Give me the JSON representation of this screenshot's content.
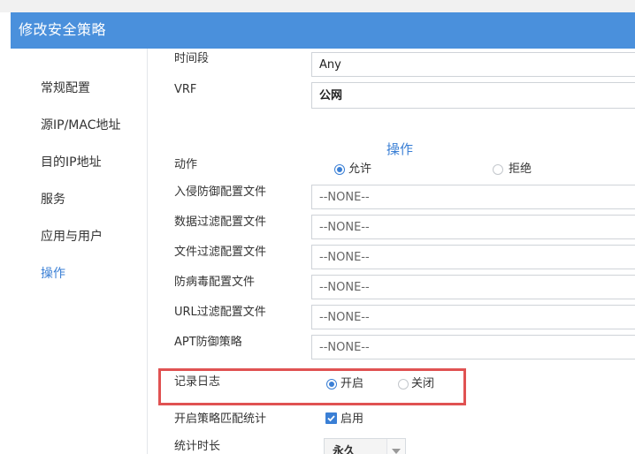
{
  "window": {
    "title": "修改安全策略"
  },
  "sidebar": {
    "items": [
      {
        "label": "常规配置"
      },
      {
        "label": "源IP/MAC地址"
      },
      {
        "label": "目的IP地址"
      },
      {
        "label": "服务"
      },
      {
        "label": "应用与用户"
      },
      {
        "label": "操作",
        "active": true
      }
    ]
  },
  "main": {
    "time_label": "时间段",
    "time_value": "Any",
    "vrf_label": "VRF",
    "vrf_value": "公网",
    "section_title": "操作",
    "action": {
      "label": "动作",
      "options": [
        "允许",
        "拒绝"
      ],
      "selected": "允许"
    },
    "profiles": [
      {
        "label": "入侵防御配置文件",
        "value": "--NONE--"
      },
      {
        "label": "数据过滤配置文件",
        "value": "--NONE--"
      },
      {
        "label": "文件过滤配置文件",
        "value": "--NONE--"
      },
      {
        "label": "防病毒配置文件",
        "value": "--NONE--"
      },
      {
        "label": "URL过滤配置文件",
        "value": "--NONE--"
      },
      {
        "label": "APT防御策略",
        "value": "--NONE--"
      }
    ],
    "logging": {
      "label": "记录日志",
      "options": [
        "开启",
        "关闭"
      ],
      "selected": "开启"
    },
    "match_stats": {
      "label": "开启策略匹配统计",
      "checkbox_label": "启用",
      "checked": true
    },
    "duration": {
      "label": "统计时长",
      "value": "永久"
    }
  },
  "colors": {
    "title_bar": "#4a90dc",
    "accent": "#3a7fd5",
    "highlight": "#e05252"
  }
}
